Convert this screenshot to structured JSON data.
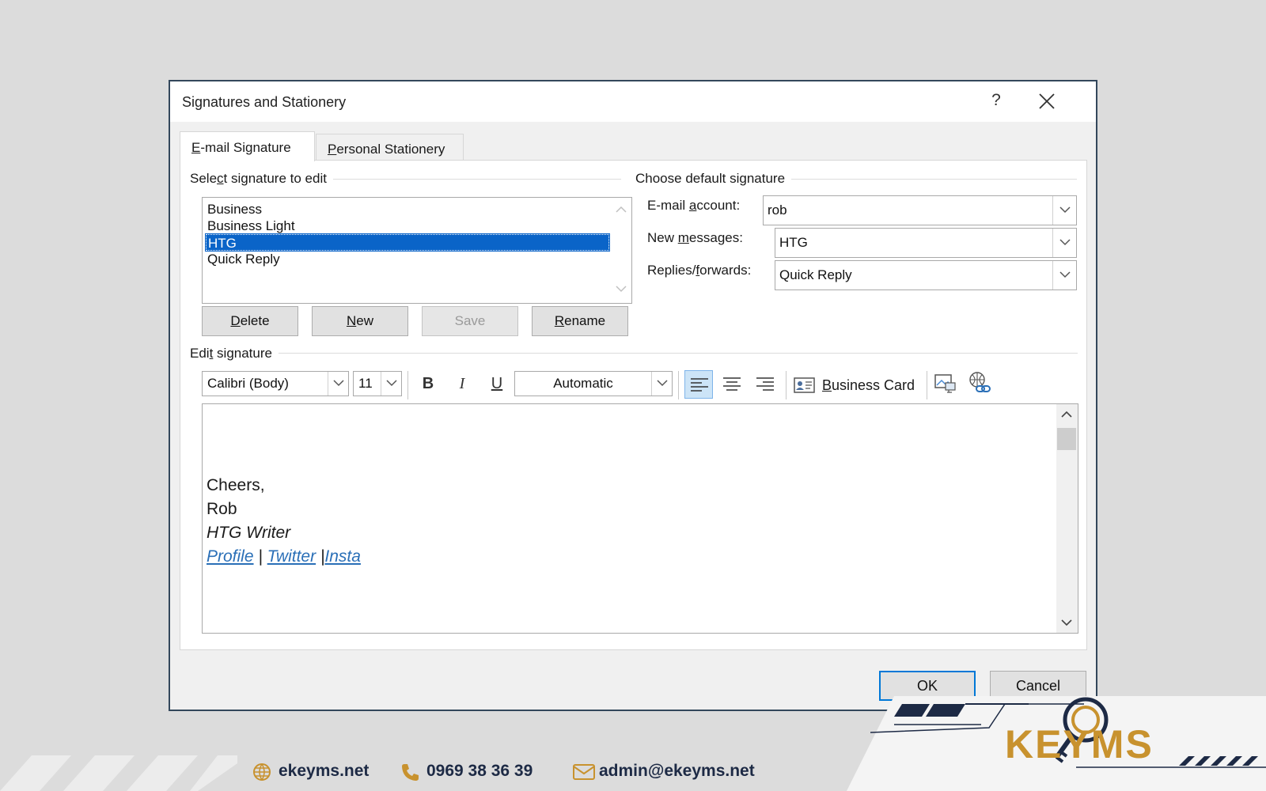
{
  "dialog": {
    "title": "Signatures and Stationery",
    "help": "?",
    "tabs": [
      {
        "pre": "",
        "key": "E",
        "post": "-mail Signature"
      },
      {
        "pre": "",
        "key": "P",
        "post": "ersonal Stationery"
      }
    ],
    "select_group": {
      "pre": "Sele",
      "key": "c",
      "post": "t signature to edit"
    },
    "signatures": [
      "Business",
      "Business Light",
      "HTG",
      "Quick Reply"
    ],
    "selected_signature": "HTG",
    "buttons": {
      "delete": {
        "key": "D",
        "post": "elete"
      },
      "new": {
        "key": "N",
        "post": "ew"
      },
      "save": "Save",
      "rename": {
        "key": "R",
        "post": "ename"
      }
    },
    "default_group": "Choose default signature",
    "email_account": {
      "pre": "E-mail ",
      "key": "a",
      "post": "ccount:",
      "value": "rob"
    },
    "new_messages": {
      "pre": "New ",
      "key": "m",
      "post": "essages:",
      "value": "HTG"
    },
    "replies": {
      "pre": "Replies/",
      "key": "f",
      "post": "orwards:",
      "value": "Quick Reply"
    },
    "edit_group": {
      "pre": "Edi",
      "key": "t",
      "post": " signature"
    },
    "toolbar": {
      "font": "Calibri (Body)",
      "size": "11",
      "bold": "B",
      "italic": "I",
      "underline": "U",
      "color": "Automatic",
      "business_card": {
        "key": "B",
        "post": "usiness Card"
      }
    },
    "signature_body": {
      "line1": "Cheers,",
      "line2": "Rob",
      "line3": "HTG Writer",
      "links": [
        "Profile",
        "Twitter",
        "Insta"
      ],
      "sep1": " | ",
      "sep2": " |"
    },
    "ok": "OK",
    "cancel": "Cancel"
  },
  "footer": {
    "website": "ekeyms.net",
    "phone": "0969 38 36 39",
    "email": "admin@ekeyms.net",
    "logo": "KEYMS"
  },
  "colors": {
    "selection": "#0a64c8",
    "link": "#2a6fb7",
    "accent_border": "#0078d7",
    "brand_navy": "#1d2a45",
    "brand_gold": "#c8922e"
  }
}
